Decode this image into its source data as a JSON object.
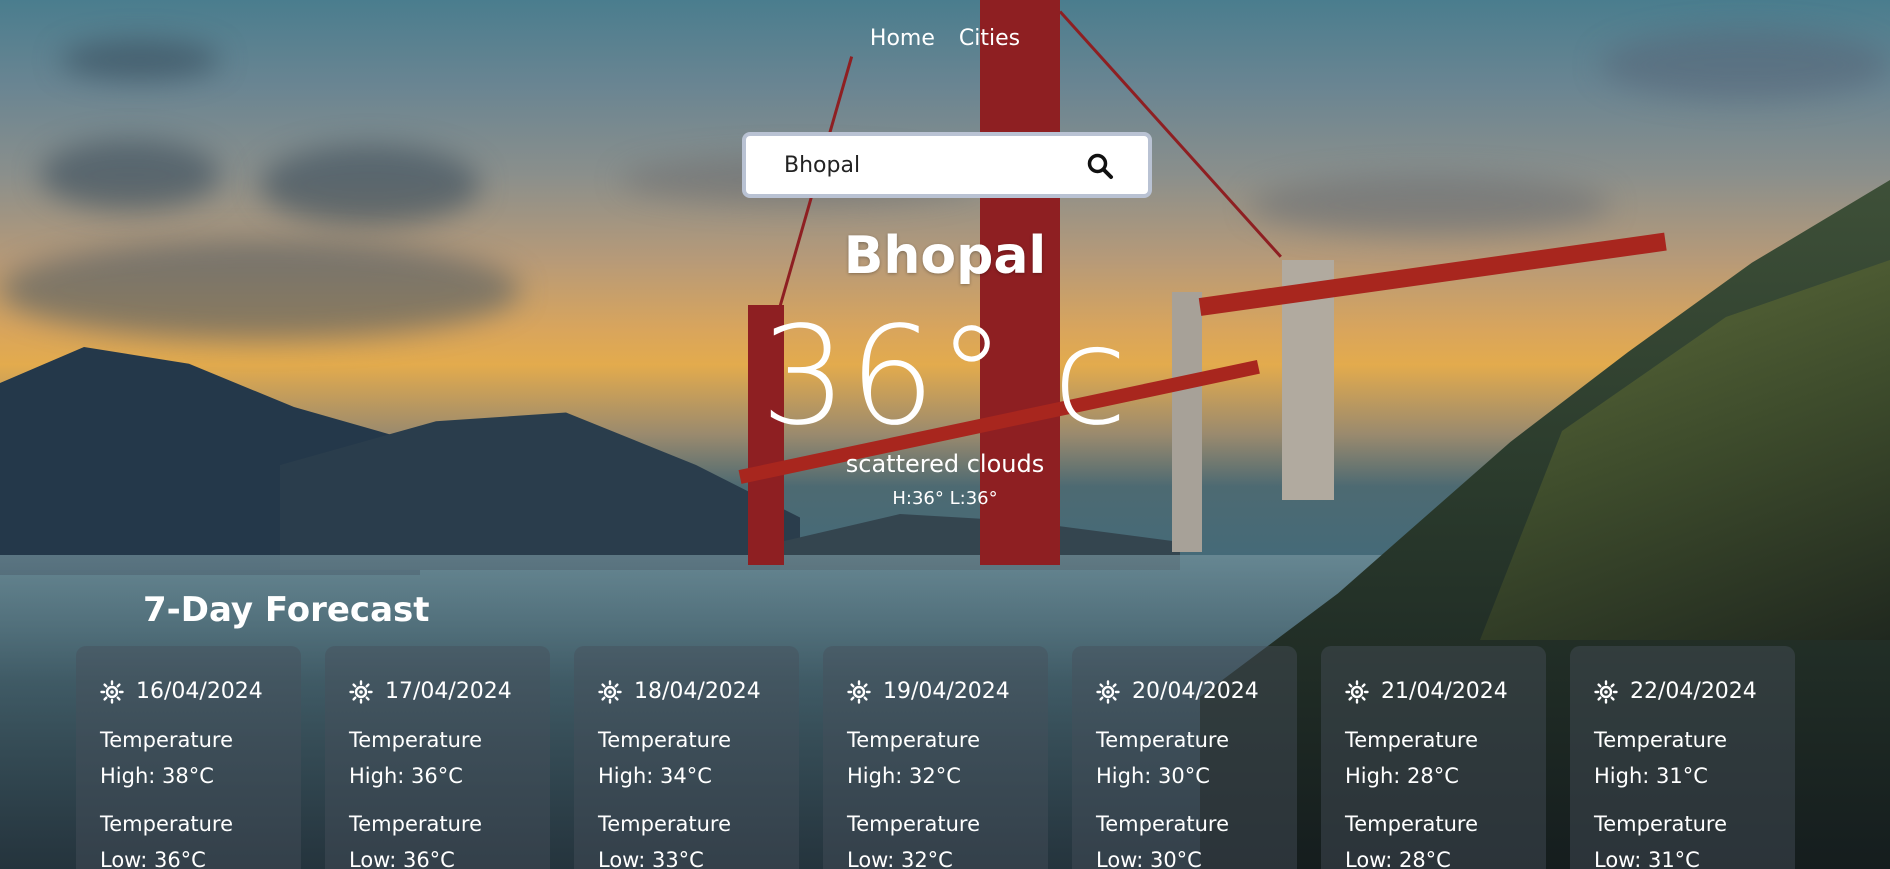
{
  "nav": {
    "home_label": "Home",
    "cities_label": "Cities"
  },
  "search": {
    "value": "Bhopal",
    "icon": "search-icon"
  },
  "current": {
    "city": "Bhopal",
    "temperature": "36° c",
    "description": "scattered clouds",
    "high_low": "H:36° L:36°"
  },
  "forecast": {
    "title": "7-Day Forecast",
    "icon": "sun-icon",
    "days": [
      {
        "date": "16/04/2024",
        "high_label": "Temperature",
        "high_value": "High: 38°C",
        "low_label": "Temperature",
        "low_value": "Low: 36°C"
      },
      {
        "date": "17/04/2024",
        "high_label": "Temperature",
        "high_value": "High: 36°C",
        "low_label": "Temperature",
        "low_value": "Low: 36°C"
      },
      {
        "date": "18/04/2024",
        "high_label": "Temperature",
        "high_value": "High: 34°C",
        "low_label": "Temperature",
        "low_value": "Low: 33°C"
      },
      {
        "date": "19/04/2024",
        "high_label": "Temperature",
        "high_value": "High: 32°C",
        "low_label": "Temperature",
        "low_value": "Low: 32°C"
      },
      {
        "date": "20/04/2024",
        "high_label": "Temperature",
        "high_value": "High: 30°C",
        "low_label": "Temperature",
        "low_value": "Low: 30°C"
      },
      {
        "date": "21/04/2024",
        "high_label": "Temperature",
        "high_value": "High: 28°C",
        "low_label": "Temperature",
        "low_value": "Low: 28°C"
      },
      {
        "date": "22/04/2024",
        "high_label": "Temperature",
        "high_value": "High: 31°C",
        "low_label": "Temperature",
        "low_value": "Low: 31°C"
      }
    ]
  }
}
